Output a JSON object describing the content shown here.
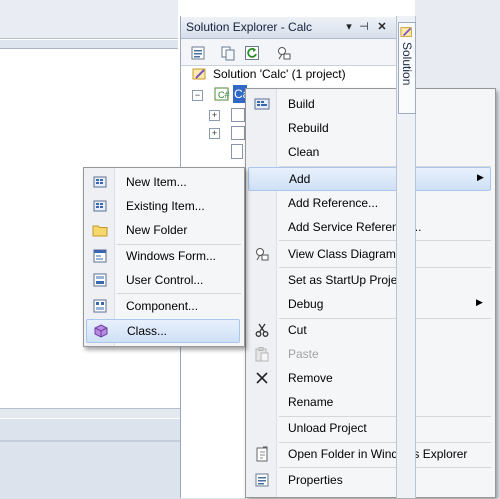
{
  "solution_explorer": {
    "title": "Solution Explorer - Calc",
    "pin_glyph": "▾",
    "dock_glyph": "⊣",
    "close_glyph": "✕",
    "side_tab_label": "Solution",
    "tree": {
      "solution_label": "Solution 'Calc' (1 project)",
      "project_label": "Calc"
    }
  },
  "context_menu": {
    "items": [
      {
        "label": "Build",
        "icon": "build-icon"
      },
      {
        "label": "Rebuild"
      },
      {
        "label": "Clean"
      },
      {
        "label": "Add",
        "submenu": true,
        "highlighted": true
      },
      {
        "label": "Add Reference..."
      },
      {
        "label": "Add Service Reference..."
      },
      {
        "label": "View Class Diagram",
        "icon": "class-diagram-icon"
      },
      {
        "label": "Set as StartUp Project"
      },
      {
        "label": "Debug",
        "submenu": true
      },
      {
        "label": "Cut",
        "icon": "scissors-icon"
      },
      {
        "label": "Paste",
        "icon": "paste-icon",
        "disabled": true
      },
      {
        "label": "Remove",
        "icon": "remove-x-icon"
      },
      {
        "label": "Rename"
      },
      {
        "label": "Unload Project"
      },
      {
        "label": "Open Folder in Windows Explorer",
        "icon": "open-folder-icon"
      },
      {
        "label": "Properties",
        "icon": "properties-icon"
      }
    ],
    "submenu_arrow": "▶"
  },
  "add_submenu": {
    "items": [
      {
        "label": "New Item...",
        "icon": "new-item-icon"
      },
      {
        "label": "Existing Item...",
        "icon": "existing-item-icon"
      },
      {
        "label": "New Folder",
        "icon": "folder-icon"
      },
      {
        "label": "Windows Form...",
        "icon": "windows-form-icon"
      },
      {
        "label": "User Control...",
        "icon": "user-control-icon"
      },
      {
        "label": "Component...",
        "icon": "component-icon"
      },
      {
        "label": "Class...",
        "icon": "class-icon",
        "highlighted": true
      }
    ]
  },
  "colors": {
    "menu_bg": "#f5f6f8",
    "highlight": "#cfe0f6",
    "disabled_text": "#a3a3a3"
  }
}
